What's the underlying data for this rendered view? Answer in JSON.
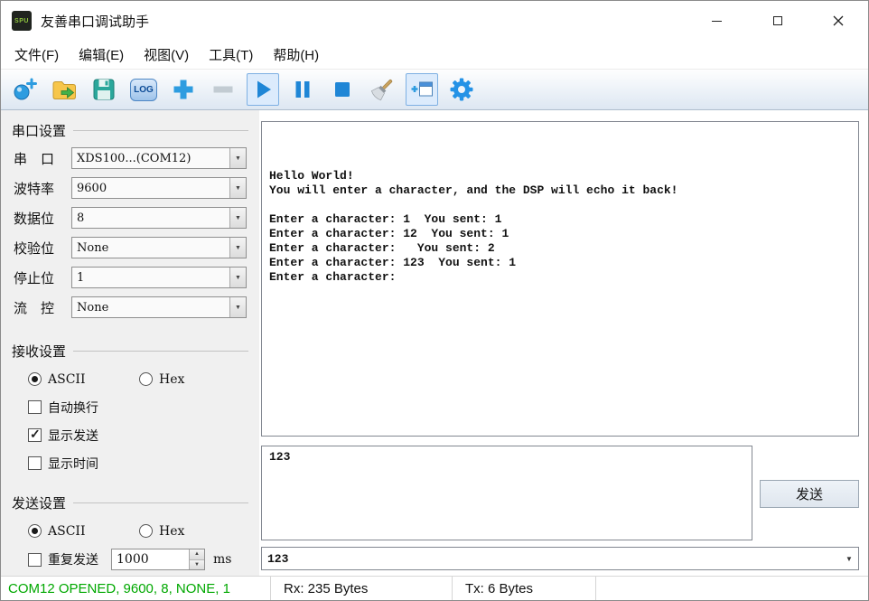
{
  "window": {
    "title": "友善串口调试助手",
    "icon_label": "SPU"
  },
  "menu": {
    "file": "文件(F)",
    "edit": "编辑(E)",
    "view": "视图(V)",
    "tools": "工具(T)",
    "help": "帮助(H)"
  },
  "toolbar": {
    "log_label": "LOG"
  },
  "serial_settings": {
    "title": "串口设置",
    "fields": [
      {
        "label": "串　口",
        "value": "XDS100...(COM12)"
      },
      {
        "label": "波特率",
        "value": "9600"
      },
      {
        "label": "数据位",
        "value": "8"
      },
      {
        "label": "校验位",
        "value": "None"
      },
      {
        "label": "停止位",
        "value": "1"
      },
      {
        "label": "流　控",
        "value": "None"
      }
    ]
  },
  "receive_settings": {
    "title": "接收设置",
    "ascii_label": "ASCII",
    "hex_label": "Hex",
    "ascii_selected": true,
    "hex_selected": false,
    "autowrap_label": "自动换行",
    "autowrap_checked": false,
    "show_send_label": "显示发送",
    "show_send_checked": true,
    "show_time_label": "显示时间",
    "show_time_checked": false
  },
  "send_settings": {
    "title": "发送设置",
    "ascii_label": "ASCII",
    "hex_label": "Hex",
    "ascii_selected": true,
    "hex_selected": false,
    "repeat_label": "重复发送",
    "repeat_checked": false,
    "interval": "1000",
    "unit": "ms"
  },
  "receive_area": {
    "text": "\n\n\nHello World!\nYou will enter a character, and the DSP will echo it back!\n\nEnter a character: 1  You sent: 1\nEnter a character: 12  You sent: 1\nEnter a character:   You sent: 2\nEnter a character: 123  You sent: 1\nEnter a character: "
  },
  "send_panel": {
    "input_text": "123",
    "send_button_label": "发送",
    "history_value": "123"
  },
  "status_bar": {
    "connection": "COM12 OPENED, 9600, 8, NONE, 1",
    "rx": "Rx: 235 Bytes",
    "tx": "Tx: 6 Bytes"
  },
  "colors": {
    "status_green": "#00a800",
    "accent_blue": "#2492e6"
  }
}
